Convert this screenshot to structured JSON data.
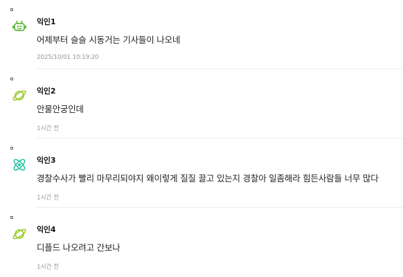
{
  "comments": [
    {
      "author": "익인1",
      "text": "어제부터 슬슬 시동거는 기사들이 나오네",
      "time": "2025/10/01 10:19:20",
      "avatar_icon": "robot-face-icon",
      "avatar_color": "#5dbb3a"
    },
    {
      "author": "익인2",
      "text": "안물안궁인데",
      "time": "1시간 전",
      "avatar_icon": "planet-icon",
      "avatar_color": "#9ccc2e"
    },
    {
      "author": "익인3",
      "text": "경찰수사가 빨리 마무리되야지 왜이렇게 질질 끌고 있는지 경찰아 일좀해라 힘든사람들 너무 많다",
      "time": "1시간 전",
      "avatar_icon": "atom-icon",
      "avatar_color": "#2cc3a6"
    },
    {
      "author": "익인4",
      "text": "디플드 나오려고 간보나",
      "time": "1시간 전",
      "avatar_icon": "planet-icon",
      "avatar_color": "#9ccc2e"
    }
  ]
}
